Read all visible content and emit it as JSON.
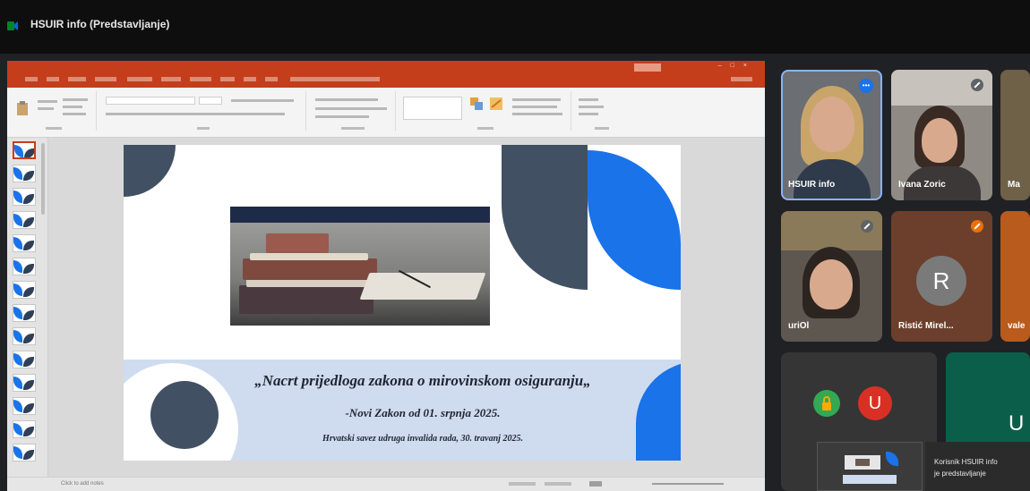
{
  "call": {
    "title": "HSUIR info (Predstavljanje)"
  },
  "slide": {
    "title": "„Nacrt prijedloga zakona o mirovinskom osiguranju„",
    "subtitle": "-Novi Zakon od 01. srpnja 2025.",
    "footer": "Hrvatski savez udruga invalida rada, 30. travanj 2025."
  },
  "ppt": {
    "notes_placeholder": "Click to add notes"
  },
  "participants": [
    {
      "name": "HSUIR info"
    },
    {
      "name": "Ivana Zoric"
    },
    {
      "name": "Ma"
    },
    {
      "name": "uriOl"
    },
    {
      "name": "Ristić Mirel..."
    },
    {
      "name": "vale"
    }
  ],
  "avatars": {
    "r_initial": "R",
    "u_initial": "U",
    "u_small": "U"
  },
  "notification": {
    "line1": "Korisnik HSUIR info",
    "line2": "je predstavljanje"
  },
  "colors": {
    "accent_blue": "#1a73e8",
    "slide_dark": "#425063",
    "ppt_red": "#c43e1c"
  }
}
